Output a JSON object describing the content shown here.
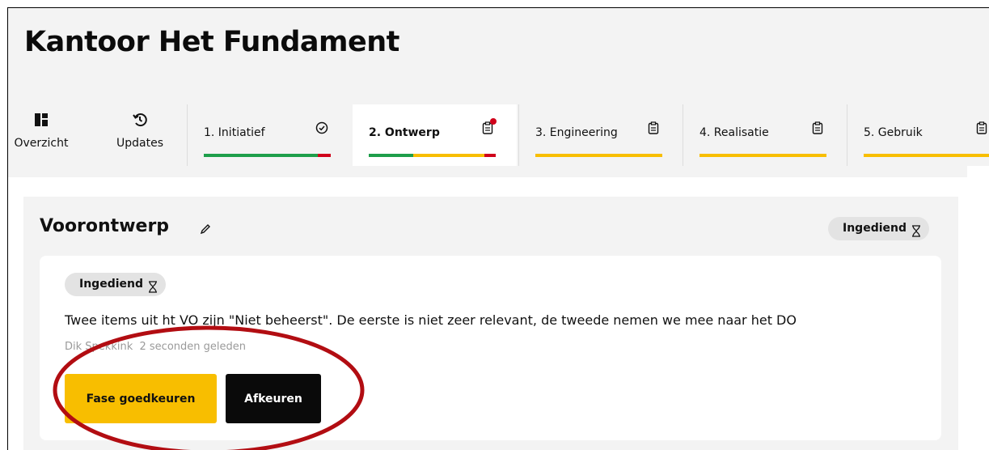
{
  "app": {
    "title": "Kantoor Het Fundament"
  },
  "nav": {
    "overview": {
      "label": "Overzicht",
      "icon": "dashboard-icon"
    },
    "updates": {
      "label": "Updates",
      "icon": "history-icon"
    }
  },
  "tabs": [
    {
      "label": "1. Initiatief",
      "icon": "check-circle-icon",
      "active": false,
      "progress": [
        {
          "color": "#1e9e4a",
          "fraction": 0.9
        },
        {
          "color": "#d0021b",
          "fraction": 0.1
        }
      ]
    },
    {
      "label": "2. Ontwerp",
      "icon": "clipboard-icon",
      "active": true,
      "notification": true,
      "progress": [
        {
          "color": "#1e9e4a",
          "fraction": 0.35
        },
        {
          "color": "#f8be00",
          "fraction": 0.56
        },
        {
          "color": "#d0021b",
          "fraction": 0.09
        }
      ]
    },
    {
      "label": "3. Engineering",
      "icon": "clipboard-icon",
      "active": false,
      "progress": [
        {
          "color": "#f8be00",
          "fraction": 1.0
        }
      ]
    },
    {
      "label": "4. Realisatie",
      "icon": "clipboard-icon",
      "active": false,
      "progress": [
        {
          "color": "#f8be00",
          "fraction": 1.0
        }
      ]
    },
    {
      "label": "5. Gebruik",
      "icon": "clipboard-icon",
      "active": false,
      "progress": [
        {
          "color": "#f8be00",
          "fraction": 1.0
        }
      ]
    }
  ],
  "phase": {
    "title": "Voorontwerp",
    "status": "Ingediend",
    "status_icon": "hourglass-icon",
    "submission": {
      "status": "Ingediend",
      "comment": "Twee items uit ht VO zijn \"Niet beheerst\". De eerste is niet zeer relevant, de tweede nemen we mee naar het DO",
      "author": "Dik Spekkink",
      "time": "2 seconden geleden",
      "approve_label": "Fase goedkeuren",
      "reject_label": "Afkeuren"
    }
  },
  "colors": {
    "accent": "#f8be00",
    "danger": "#d0021b",
    "success": "#1e9e4a",
    "annotation": "#b20d12"
  }
}
